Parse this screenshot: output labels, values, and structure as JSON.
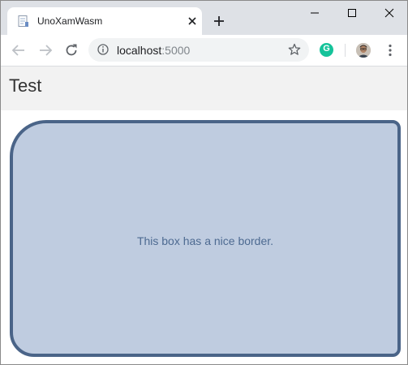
{
  "browser": {
    "tab": {
      "title": "UnoXamWasm"
    },
    "address_bar": {
      "host": "localhost",
      "port": ":5000"
    },
    "icons": {
      "favicon": "page-icon",
      "tab_close": "close-icon",
      "new_tab": "plus-icon",
      "back": "arrow-left-icon",
      "forward": "arrow-right-icon",
      "reload": "reload-icon",
      "site_info": "info-icon",
      "bookmark": "star-icon",
      "extension": "grammarly-icon",
      "profile": "avatar",
      "menu": "kebab-menu-icon",
      "minimize": "minimize-icon",
      "maximize": "maximize-icon",
      "close_window": "close-icon"
    },
    "extension_letter": "G"
  },
  "page": {
    "title": "Test",
    "box": {
      "text": "This box has a nice border.",
      "fill_color": "#bfcce0",
      "border_color": "#4a6488",
      "text_color": "#4d6a91"
    }
  }
}
